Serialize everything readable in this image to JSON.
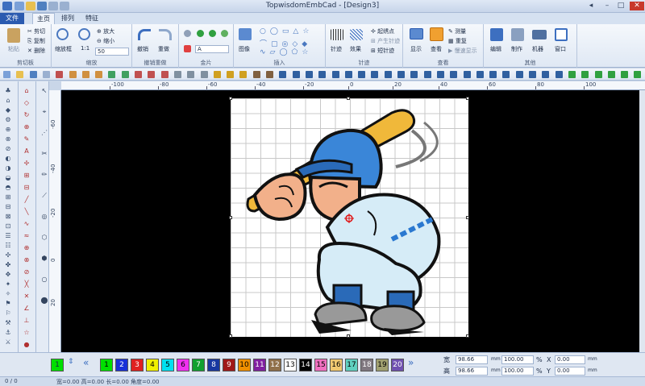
{
  "window": {
    "title": "TopwisdomEmbCad - [Design3]"
  },
  "tabs": [
    "文件",
    "主页",
    "排列",
    "特征"
  ],
  "ribbon": {
    "clipboard": {
      "label": "剪切板",
      "paste": "粘贴",
      "cut": "剪切",
      "copy": "复制",
      "delete": "删除"
    },
    "zoom": {
      "label": "缩放",
      "zoom_box": "缩放框",
      "ratio": "1:1",
      "zoom_in": "放大",
      "zoom_out": "缩小",
      "value": "50"
    },
    "undo": {
      "label": "撤销重做",
      "undo": "撤销",
      "redo": "重做"
    },
    "sequin": {
      "label": "金片",
      "value": "A"
    },
    "insert": {
      "label": "插入",
      "image": "图像"
    },
    "stitch": {
      "label": "针迹",
      "stitch": "针迹",
      "effect": "效果",
      "start_point": "起绣点",
      "generate": "产生针迹",
      "short": "短针迹"
    },
    "view": {
      "label": "查看",
      "display": "显示",
      "view": "查看",
      "measure": "测量",
      "repeat": "重复",
      "slow": "慢速显示"
    },
    "other": {
      "label": "其他",
      "edit": "编辑",
      "make": "制作",
      "machine": "机器",
      "window": "窗口"
    }
  },
  "ruler": {
    "h_labels": [
      "-100",
      "-80",
      "-60",
      "-40",
      "-20",
      "0",
      "20",
      "40",
      "60",
      "80",
      "100"
    ],
    "v_labels": [
      "-60",
      "-40",
      "-20",
      "0",
      "20",
      "40"
    ]
  },
  "palette": {
    "current": "1",
    "colors": [
      {
        "n": "1",
        "c": "#00e000"
      },
      {
        "n": "2",
        "c": "#1830d8"
      },
      {
        "n": "3",
        "c": "#e02020"
      },
      {
        "n": "4",
        "c": "#f0f000"
      },
      {
        "n": "5",
        "c": "#00e0f0"
      },
      {
        "n": "6",
        "c": "#f030f0"
      },
      {
        "n": "7",
        "c": "#10a030"
      },
      {
        "n": "8",
        "c": "#1838a0"
      },
      {
        "n": "9",
        "c": "#a01818"
      },
      {
        "n": "10",
        "c": "#f09000"
      },
      {
        "n": "11",
        "c": "#8020a0"
      },
      {
        "n": "12",
        "c": "#90704a"
      },
      {
        "n": "13",
        "c": "#ffffff"
      },
      {
        "n": "14",
        "c": "#000000"
      },
      {
        "n": "15",
        "c": "#f070c0"
      },
      {
        "n": "16",
        "c": "#f0c870"
      },
      {
        "n": "17",
        "c": "#60d0c0"
      },
      {
        "n": "18",
        "c": "#807880"
      },
      {
        "n": "19",
        "c": "#a0a070"
      },
      {
        "n": "20",
        "c": "#7050b0"
      }
    ]
  },
  "properties": {
    "width_label": "宽",
    "width_value": "98.66",
    "width_unit": "mm",
    "width_pct": "100.00",
    "pct": "%",
    "x_label": "X",
    "x_value": "0.00",
    "height_label": "高",
    "height_value": "98.66",
    "height_unit": "mm",
    "height_pct": "100.00",
    "y_label": "Y",
    "y_value": "0.00",
    "unit": "mm"
  },
  "status": {
    "left": "0 / 0",
    "info": "宽=0.00 高=0.00 长=0.00 角度=0.00"
  },
  "colors": {
    "accent": "#2b5bb0",
    "canvas": "#000000"
  }
}
